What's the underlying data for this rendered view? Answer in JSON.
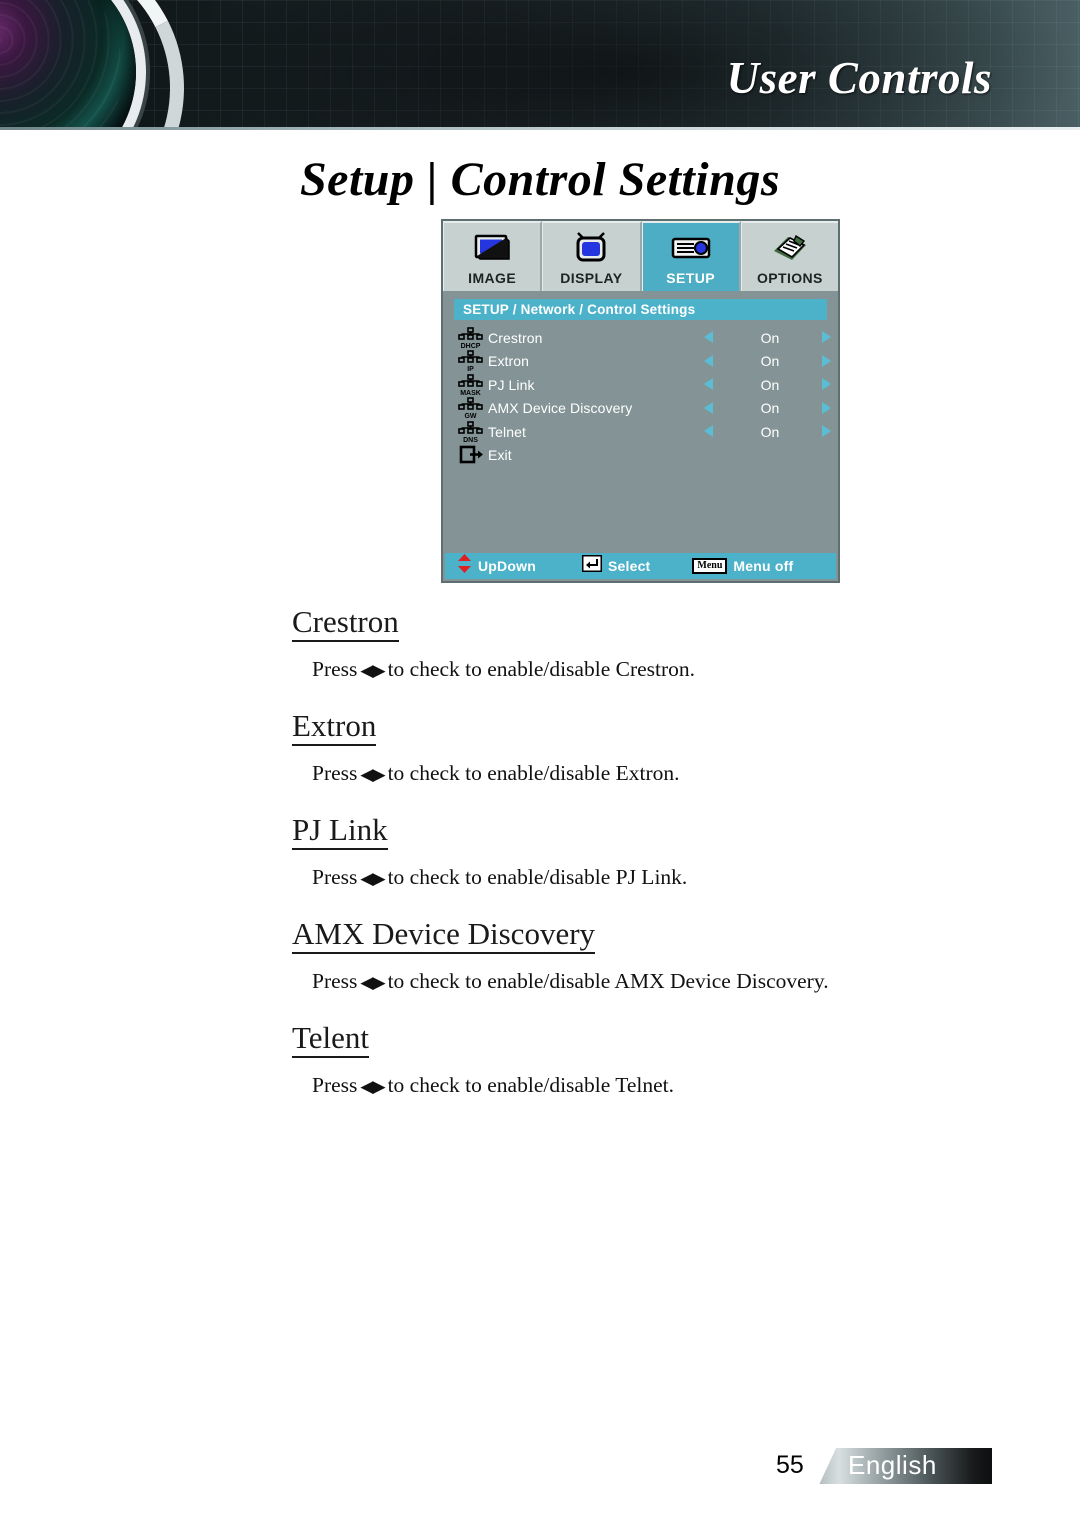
{
  "header": {
    "title": "User Controls",
    "lens_icon": "camera-lens-graphic"
  },
  "page_title": "Setup | Control Settings",
  "osd": {
    "tabs": [
      {
        "label": "IMAGE",
        "icon": "monitor-icon",
        "active": false
      },
      {
        "label": "DISPLAY",
        "icon": "tv-icon",
        "active": false
      },
      {
        "label": "SETUP",
        "icon": "projector-icon",
        "active": true
      },
      {
        "label": "OPTIONS",
        "icon": "notepad-pencil-icon",
        "active": false
      }
    ],
    "breadcrumb": "SETUP / Network / Control Settings",
    "rows": [
      {
        "label": "Crestron",
        "value": "On",
        "icon": "network-node-icon",
        "icon_caption": "DHCP"
      },
      {
        "label": "Extron",
        "value": "On",
        "icon": "network-node-icon",
        "icon_caption": "IP"
      },
      {
        "label": "PJ Link",
        "value": "On",
        "icon": "network-node-icon",
        "icon_caption": "MASK"
      },
      {
        "label": "AMX Device Discovery",
        "value": "On",
        "icon": "network-node-icon",
        "icon_caption": "GW"
      },
      {
        "label": "Telnet",
        "value": "On",
        "icon": "network-node-icon",
        "icon_caption": "DNS"
      }
    ],
    "exit": {
      "label": "Exit",
      "icon": "exit-door-icon"
    },
    "status_bar": [
      {
        "label": "UpDown",
        "icon": "up-down-arrow-icon"
      },
      {
        "label": "Select",
        "icon": "enter-key-icon"
      },
      {
        "label": "Menu off",
        "icon": "menu-key-icon",
        "key_text": "Menu"
      }
    ],
    "colors": {
      "panel_bg": "#849496",
      "accent_cyan": "#4cb2ca",
      "active_tab": "#4dadc4",
      "tab_bg": "#c6d1d0",
      "text": "#ffffff"
    }
  },
  "sections": [
    {
      "heading": "Crestron",
      "body_before": "Press",
      "arrows": "◀▶",
      "body_after": "to check to enable/disable Crestron."
    },
    {
      "heading": "Extron",
      "body_before": "Press",
      "arrows": "◀▶",
      "body_after": "to check to enable/disable Extron."
    },
    {
      "heading": "PJ Link",
      "body_before": "Press",
      "arrows": "◀▶",
      "body_after": "to check to enable/disable PJ Link."
    },
    {
      "heading": "AMX Device Discovery",
      "body_before": "Press",
      "arrows": "◀▶",
      "body_after": "to check to enable/disable AMX Device Discovery."
    },
    {
      "heading": "Telent",
      "body_before": "Press",
      "arrows": "◀▶",
      "body_after": "to check to enable/disable Telnet."
    }
  ],
  "footer": {
    "page_number": "55",
    "language": "English"
  }
}
